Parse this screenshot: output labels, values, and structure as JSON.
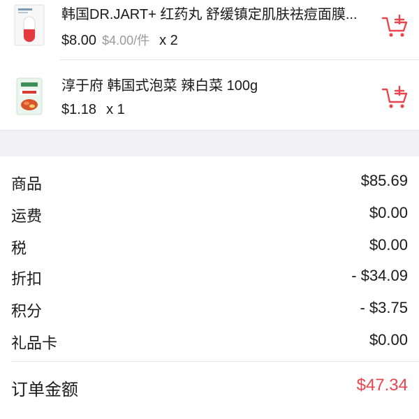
{
  "items": [
    {
      "title": "韩国DR.JART+ 红药丸 舒缓镇定肌肤祛痘面膜...",
      "price": "$8.00",
      "unit_price": "$4.00/件",
      "qty": "x 2",
      "thumb_icon": "face-mask-product-icon"
    },
    {
      "title": "淳于府 韩国式泡菜 辣白菜 100g",
      "price": "$1.18",
      "unit_price": "",
      "qty": "x 1",
      "thumb_icon": "kimchi-product-icon"
    }
  ],
  "summary": {
    "goods_label": "商品",
    "goods_value": "$85.69",
    "shipping_label": "运费",
    "shipping_value": "$0.00",
    "tax_label": "税",
    "tax_value": "$0.00",
    "discount_label": "折扣",
    "discount_value": "- $34.09",
    "points_label": "积分",
    "points_value": "- $3.75",
    "giftcard_label": "礼品卡",
    "giftcard_value": "$0.00",
    "total_label": "订单金额",
    "total_value": "$47.34"
  },
  "colors": {
    "accent": "#e8464e",
    "muted": "#9a9a9a",
    "section_gap": "#f2f2f4"
  }
}
